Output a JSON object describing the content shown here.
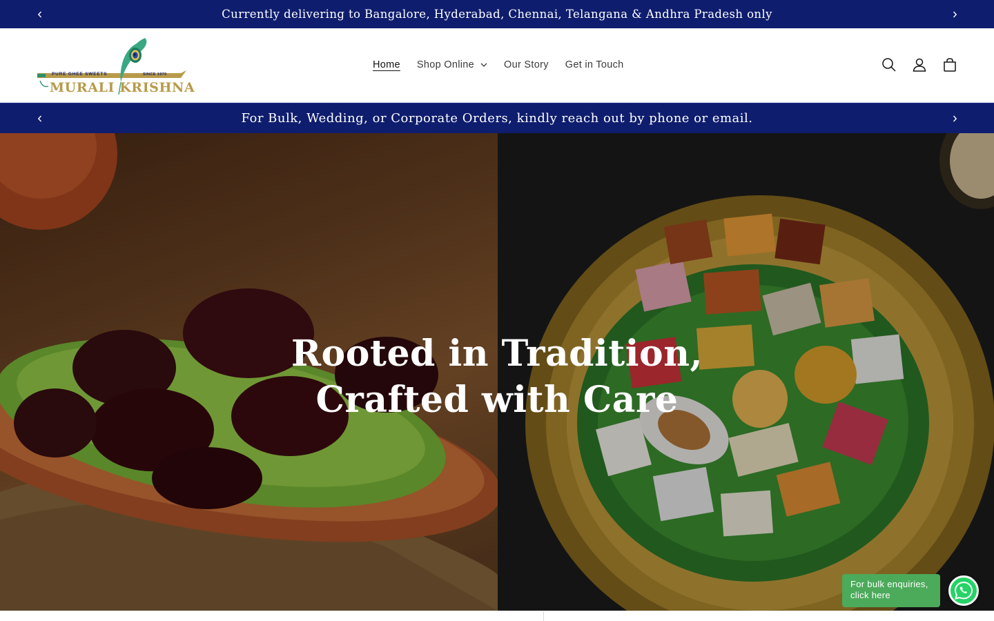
{
  "announcement_top": {
    "text": "Currently delivering to Bangalore, Hyderabad, Chennai, Telangana & Andhra Pradesh only",
    "prev_icon": "chevron-left-icon",
    "next_icon": "chevron-right-icon"
  },
  "header": {
    "logo": {
      "tagline": "PURE GHEE SWEETS",
      "since": "SINCE 1970",
      "brand": "MURALI KRISHNA"
    },
    "nav": [
      {
        "label": "Home",
        "active": true
      },
      {
        "label": "Shop Online",
        "has_dropdown": true
      },
      {
        "label": "Our Story"
      },
      {
        "label": "Get in Touch"
      }
    ],
    "icons": [
      "search-icon",
      "account-icon",
      "cart-icon"
    ]
  },
  "announcement_mid": {
    "text": "For Bulk, Wedding, or Corporate Orders, kindly reach out by phone or email.",
    "prev_icon": "chevron-left-icon",
    "next_icon": "chevron-right-icon"
  },
  "hero": {
    "heading_line1": "Rooted in Tradition,",
    "heading_line2": "Crafted with Care"
  },
  "whatsapp": {
    "chip_text": "For bulk enquiries, click here",
    "icon": "whatsapp-icon"
  },
  "colors": {
    "announcement_bg": "#0f1d6e",
    "whatsapp_green": "#25d366",
    "chip_green": "#4caa5b",
    "brand_gold": "#b89a4a"
  }
}
